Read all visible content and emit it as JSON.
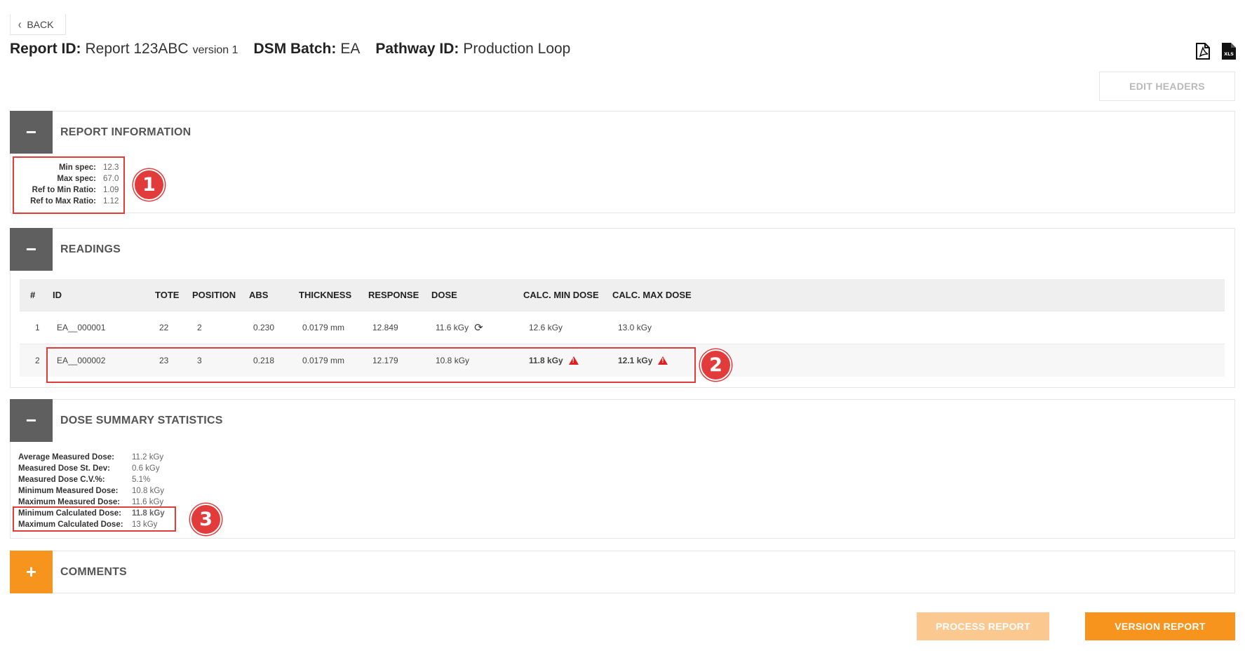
{
  "nav": {
    "back_label": "BACK"
  },
  "header": {
    "report_id_label": "Report ID:",
    "report_id_value": "Report 123ABC",
    "version_text": "version 1",
    "dsm_batch_label": "DSM Batch:",
    "dsm_batch_value": "EA",
    "pathway_id_label": "Pathway ID:",
    "pathway_id_value": "Production Loop",
    "xls_icon_text": "XLS",
    "edit_headers_label": "EDIT HEADERS"
  },
  "report_info": {
    "title": "REPORT INFORMATION",
    "toggle": "−",
    "rows": [
      {
        "label": "Min spec:",
        "value": "12.3"
      },
      {
        "label": "Max spec:",
        "value": "67.0"
      },
      {
        "label": "Ref to Min Ratio:",
        "value": "1.09"
      },
      {
        "label": "Ref to Max Ratio:",
        "value": "1.12"
      }
    ]
  },
  "readings": {
    "title": "READINGS",
    "toggle": "−",
    "columns": [
      "#",
      "ID",
      "TOTE",
      "POSITION",
      "ABS",
      "THICKNESS",
      "RESPONSE",
      "DOSE",
      "CALC. MIN DOSE",
      "CALC. MAX DOSE"
    ],
    "rows": [
      {
        "num": "1",
        "id": "EA__000001",
        "tote": "22",
        "position": "2",
        "abs": "0.230",
        "thickness": "0.0179 mm",
        "response": "12.849",
        "dose": "11.6 kGy",
        "calc_min": "12.6 kGy",
        "calc_max": "13.0 kGy"
      },
      {
        "num": "2",
        "id": "EA__000002",
        "tote": "23",
        "position": "3",
        "abs": "0.218",
        "thickness": "0.0179 mm",
        "response": "12.179",
        "dose": "10.8 kGy",
        "calc_min": "11.8 kGy",
        "calc_max": "12.1 kGy"
      }
    ]
  },
  "dose_summary": {
    "title": "DOSE SUMMARY STATISTICS",
    "toggle": "−",
    "rows": [
      {
        "label": "Average Measured Dose:",
        "value": "11.2 kGy"
      },
      {
        "label": "Measured Dose St. Dev:",
        "value": "0.6 kGy"
      },
      {
        "label": "Measured Dose C.V.%:",
        "value": "5.1%"
      },
      {
        "label": "Minimum Measured Dose:",
        "value": "10.8 kGy"
      },
      {
        "label": "Maximum Measured Dose:",
        "value": "11.6 kGy"
      },
      {
        "label": "Minimum Calculated Dose:",
        "value": "11.8 kGy"
      },
      {
        "label": "Maximum Calculated Dose:",
        "value": "13 kGy"
      }
    ]
  },
  "comments": {
    "title": "COMMENTS",
    "toggle": "+"
  },
  "annotations": [
    "1",
    "2",
    "3"
  ],
  "actions": {
    "process_label": "PROCESS REPORT",
    "version_label": "VERSION REPORT"
  },
  "colors": {
    "accent": "#f7941d",
    "accent_disabled": "#fbc990",
    "warning": "#e02020",
    "annotation": "#e23b3b",
    "toggle_dark": "#5f5f5f"
  }
}
